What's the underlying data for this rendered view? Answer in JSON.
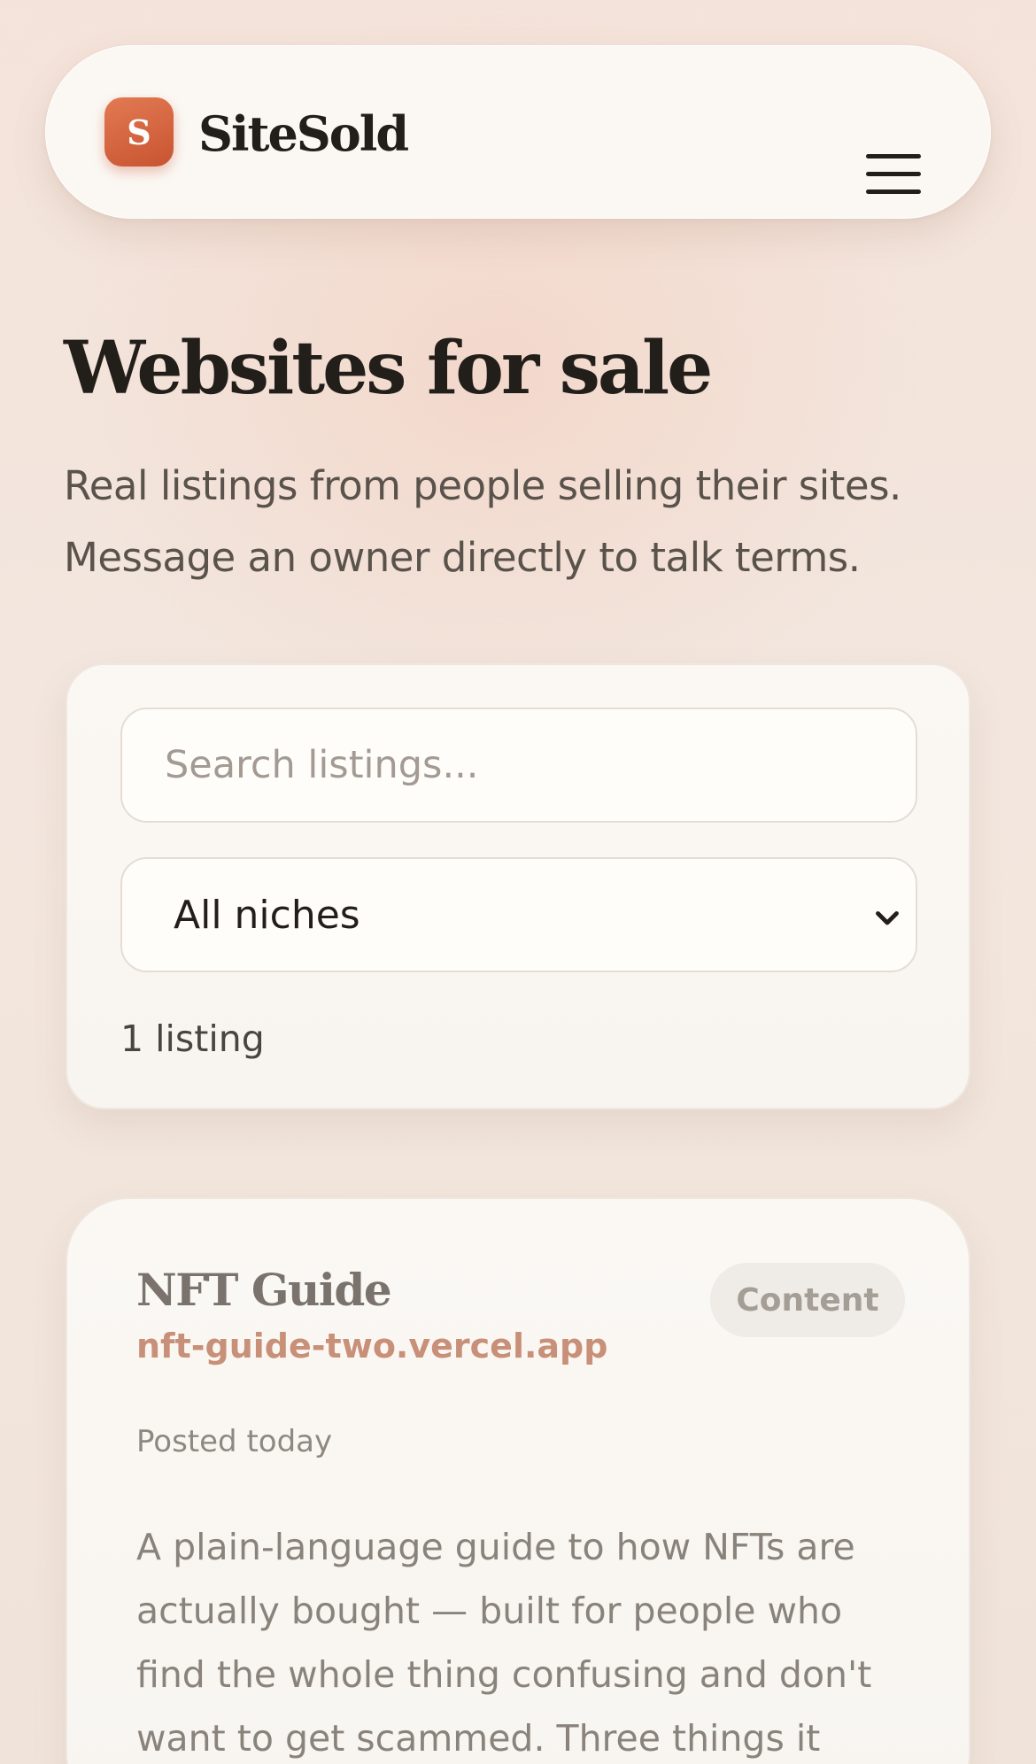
{
  "header": {
    "logo_letter": "S",
    "brand": "SiteSold",
    "menu_icon": "hamburger-menu-icon"
  },
  "hero": {
    "title": "Websites for sale",
    "subtitle": "Real listings from people selling their sites. Message an owner directly to talk terms."
  },
  "filters": {
    "search_placeholder": "Search listings...",
    "search_value": "",
    "niche_selected": "All niches",
    "count_text": "1 listing"
  },
  "listings": [
    {
      "title": "NFT Guide",
      "url": "nft-guide-two.vercel.app",
      "category": "Content",
      "posted": "Posted today",
      "description": "A plain-language guide to how NFTs are actually bought — built for people who find the whole thing confusing and don't want to get scammed. Three things it"
    }
  ],
  "colors": {
    "accent": "#d2643e",
    "url_text": "#c89078",
    "background": "#f3e4dc",
    "card": "#fbf8f4"
  }
}
